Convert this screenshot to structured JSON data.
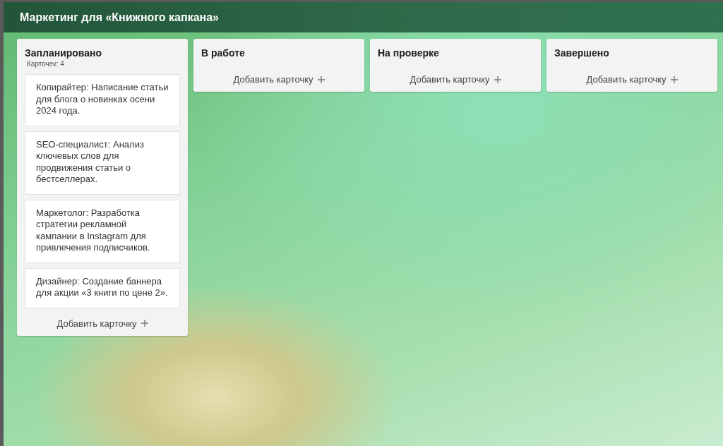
{
  "board": {
    "title": "Маркетинг для «Книжного капкана»"
  },
  "columns": [
    {
      "title": "Запланировано",
      "count": "Карточек: 4",
      "cards": [
        {
          "text": "Копирайтер: Написание статьи для блога о новинках осени 2024 года."
        },
        {
          "text": "SEO-специалист: Анализ ключевых слов для продвижения статьи о бестселлерах."
        },
        {
          "text": "Маркетолог: Разработка стратегии рекламной кампании в Instagram для привлечения подписчиков."
        },
        {
          "text": "Дизайнер: Создание баннера для акции «3 книги по цене 2»."
        }
      ],
      "add_label": "Добавить карточку"
    },
    {
      "title": "В работе",
      "add_label": "Добавить карточку"
    },
    {
      "title": "На проверке",
      "add_label": "Добавить карточку"
    },
    {
      "title": "Завершено",
      "add_label": "Добавить карточку"
    }
  ]
}
